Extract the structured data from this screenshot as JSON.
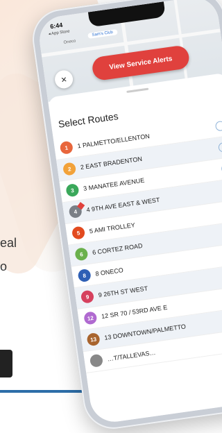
{
  "background": {
    "text_line1": "eal",
    "text_line2": "o"
  },
  "status_bar": {
    "time": "6:44",
    "back_app": "◂ App Store"
  },
  "map": {
    "labels": [
      "Oneco",
      "Sam's Club"
    ]
  },
  "header": {
    "close_label": "×",
    "alert_button_label": "View Service Alerts"
  },
  "sheet": {
    "title": "Select Routes"
  },
  "routes": [
    {
      "badge": "1",
      "name": "1 PALMETTO/ELLENTON",
      "color": "#e8663c"
    },
    {
      "badge": "2",
      "name": "2 EAST BRADENTON",
      "color": "#f2a23a"
    },
    {
      "badge": "3",
      "name": "3 MANATEE AVENUE",
      "color": "#3aa85a"
    },
    {
      "badge": "4",
      "name": "4 9TH AVE EAST & WEST",
      "color": "#7a7f86",
      "alert": true
    },
    {
      "badge": "5",
      "name": "5 AMI TROLLEY",
      "color": "#e24a1f"
    },
    {
      "badge": "6",
      "name": "6 CORTEZ ROAD",
      "color": "#6ab04c"
    },
    {
      "badge": "8",
      "name": "8 ONECO",
      "color": "#2e5fb5"
    },
    {
      "badge": "9",
      "name": "9 26TH ST WEST",
      "color": "#d6415e"
    },
    {
      "badge": "12",
      "name": "12 SR 70 / 53RD AVE E",
      "color": "#b06ad0"
    },
    {
      "badge": "13",
      "name": "13 DOWNTOWN/PALMETTO",
      "color": "#a8642e"
    },
    {
      "badge": "",
      "name": "…T/TALLEVAS…",
      "color": "#888888"
    }
  ]
}
